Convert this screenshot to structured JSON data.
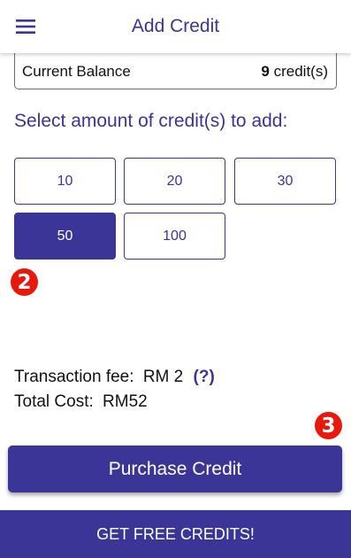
{
  "appbar": {
    "title": "Add Credit",
    "menu_icon": "hamburger-menu-icon"
  },
  "balance": {
    "label": "Current Balance",
    "value": "9",
    "unit": " credit(s)"
  },
  "select": {
    "heading": "Select amount of credit(s) to add:",
    "options": [
      "10",
      "20",
      "30",
      "50",
      "100"
    ],
    "selected": "50"
  },
  "markers": {
    "step2": "2",
    "step3": "3",
    "color": "#e8190c"
  },
  "fees": {
    "fee_label": "Transaction fee:",
    "fee_value": "RM 2",
    "help": "(?)",
    "total_label": "Total Cost:",
    "total_value": "RM52"
  },
  "actions": {
    "purchase": "Purchase Credit",
    "free_credits": "GET FREE CREDITS!"
  },
  "colors": {
    "accent": "#3a3596",
    "text": "#111111",
    "background": "#ffffff"
  }
}
